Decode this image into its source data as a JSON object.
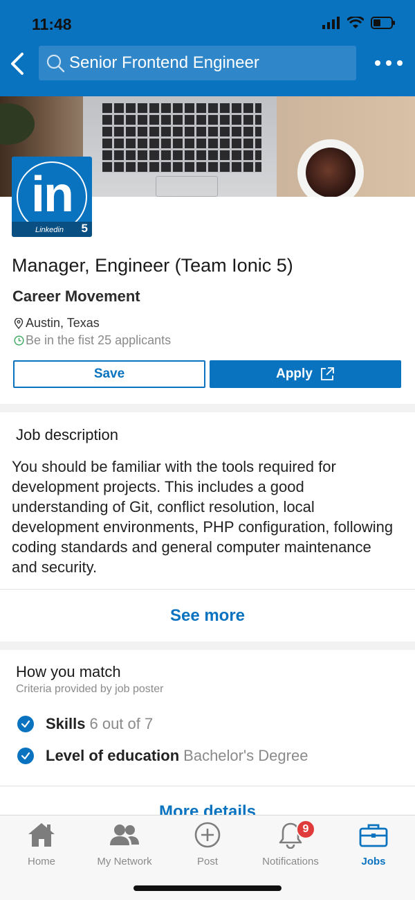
{
  "status_bar": {
    "time": "11:48"
  },
  "header": {
    "search_value": "Senior Frontend Engineer",
    "back_icon": "chevron-left-icon",
    "more_icon": "more-dots-icon"
  },
  "company_logo": {
    "letters": "in",
    "caption": "Linkedin",
    "badge": "5"
  },
  "job": {
    "title": "Manager, Engineer (Team Ionic 5)",
    "company": "Career Movement",
    "location": "Austin, Texas",
    "applicants": "Be in the fist 25 applicants",
    "save_label": "Save",
    "apply_label": "Apply"
  },
  "description": {
    "heading": "Job description",
    "body": "You should be familiar with the tools required for development projects. This includes a good understanding of Git, conflict resolution, local development environments, PHP configuration, following coding standards and general computer maintenance and security.",
    "see_more": "See more"
  },
  "match": {
    "heading": "How you match",
    "subheading": "Criteria provided by job poster",
    "items": [
      {
        "label": "Skills",
        "value": "6 out of 7"
      },
      {
        "label": "Level of education",
        "value": "Bachelor's Degree"
      }
    ],
    "more_details": "More details"
  },
  "bottom_nav": {
    "items": [
      {
        "label": "Home",
        "icon": "home-icon"
      },
      {
        "label": "My Network",
        "icon": "network-icon"
      },
      {
        "label": "Post",
        "icon": "plus-circle-icon"
      },
      {
        "label": "Notifications",
        "icon": "bell-icon",
        "badge": "9"
      },
      {
        "label": "Jobs",
        "icon": "briefcase-icon",
        "active": true
      }
    ]
  },
  "colors": {
    "brand": "#0a73c0",
    "badge": "#e03b3b"
  }
}
